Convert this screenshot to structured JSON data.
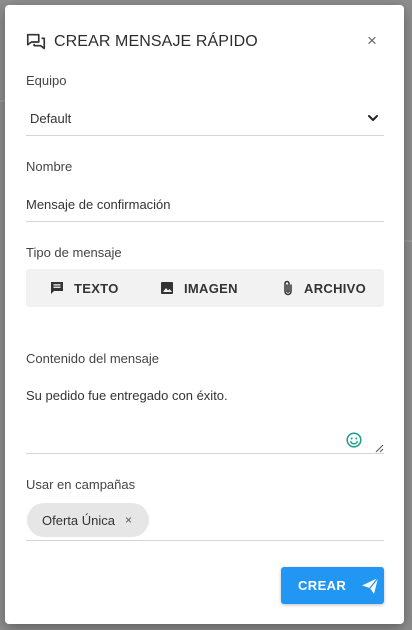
{
  "dialog": {
    "title": "CREAR MENSAJE RÁPIDO",
    "close_glyph": "×",
    "icons": {
      "header": "quick-message-icon",
      "close": "close-icon"
    }
  },
  "form": {
    "team": {
      "label": "Equipo",
      "value": "Default"
    },
    "name": {
      "label": "Nombre",
      "value": "Mensaje de confirmación"
    },
    "message_type": {
      "label": "Tipo de mensaje",
      "options": [
        {
          "label": "TEXTO",
          "icon": "message-text-icon"
        },
        {
          "label": "IMAGEN",
          "icon": "image-icon"
        },
        {
          "label": "ARCHIVO",
          "icon": "attachment-icon"
        }
      ]
    },
    "content": {
      "label": "Contenido del mensaje",
      "value": "Su pedido fue entregado con éxito."
    },
    "campaigns": {
      "label": "Usar en campañas",
      "chips": [
        {
          "label": "Oferta Única",
          "remove_glyph": "×"
        }
      ]
    }
  },
  "actions": {
    "create_label": "CREAR",
    "create_icon": "send-icon"
  },
  "colors": {
    "primary": "#2196f3",
    "emoji": "#1a9e8e",
    "type_bar": "#f2f2f2",
    "chip": "#e6e6e6"
  }
}
